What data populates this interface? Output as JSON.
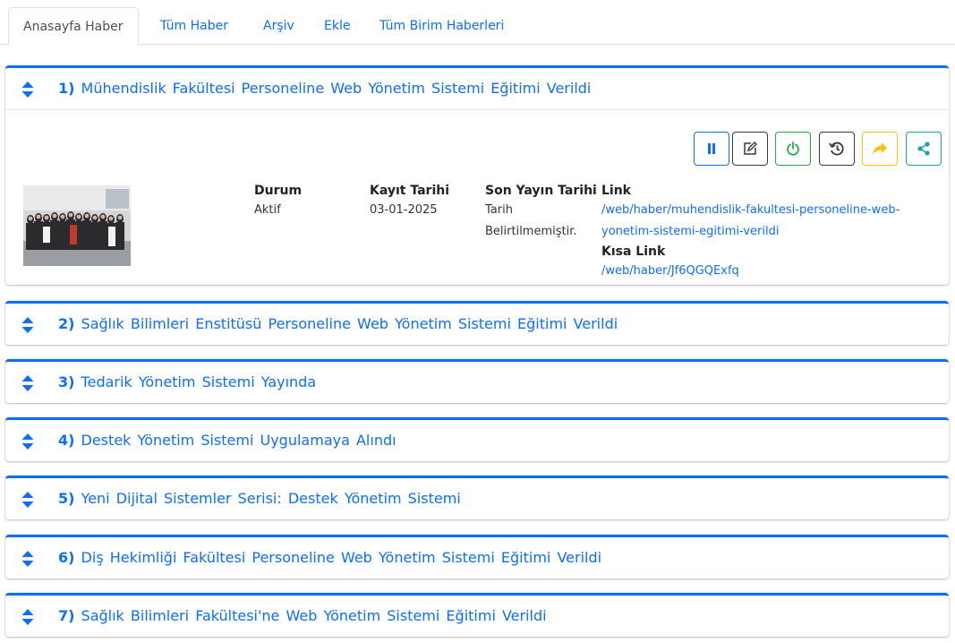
{
  "tabs": [
    {
      "label": "Anasayfa Haber",
      "active": true
    },
    {
      "label": "Tüm Haber",
      "active": false
    },
    {
      "label": "Arşiv",
      "active": false
    },
    {
      "label": "Ekle",
      "active": false
    },
    {
      "label": "Tüm Birim Haberleri",
      "active": false
    }
  ],
  "colors": {
    "primary": "#0d6efd",
    "success": "#28a745",
    "warning": "#ffc107",
    "info": "#17a2b8",
    "dark": "#343a40",
    "secondary": "#6c757d"
  },
  "news": [
    {
      "num": "1)",
      "title": "Mühendislik Fakültesi Personeline Web Yönetim Sistemi Eğitimi Verildi",
      "expanded": true,
      "details": {
        "status_label": "Durum",
        "status_value": "Aktif",
        "record_label": "Kayıt Tarihi",
        "record_value": "03-01-2025",
        "publish_label": "Son Yayın Tarihi",
        "publish_value_line1": "Tarih",
        "publish_value_line2": "Belirtilmemiştir.",
        "link_label": "Link",
        "link_line1": "/web/haber/muhendislik-fakultesi-personeline-web-",
        "link_line2": "yonetim-sistemi-egitimi-verildi",
        "short_link_label": "Kısa Link",
        "short_link_value": "/web/haber/Jf6QGQExfq"
      },
      "actions": [
        {
          "name": "pause-button",
          "icon": "pause-icon",
          "color": "#0d6efd"
        },
        {
          "name": "edit-button",
          "icon": "edit-icon",
          "color": "#343a40"
        },
        {
          "name": "power-button",
          "icon": "power-icon",
          "color": "#28a745"
        },
        {
          "name": "history-button",
          "icon": "history-icon",
          "color": "#343a40"
        },
        {
          "name": "forward-button",
          "icon": "share-arrow-icon",
          "color": "#ffc107"
        },
        {
          "name": "share-button",
          "icon": "share-nodes-icon",
          "color": "#17a2b8"
        }
      ]
    },
    {
      "num": "2)",
      "title": "Sağlık Bilimleri Enstitüsü Personeline Web Yönetim Sistemi Eğitimi Verildi",
      "expanded": false
    },
    {
      "num": "3)",
      "title": "Tedarik Yönetim Sistemi Yayında",
      "expanded": false
    },
    {
      "num": "4)",
      "title": "Destek Yönetim Sistemi Uygulamaya Alındı",
      "expanded": false
    },
    {
      "num": "5)",
      "title": "Yeni Dijital Sistemler Serisi: Destek Yönetim Sistemi",
      "expanded": false
    },
    {
      "num": "6)",
      "title": "Diş Hekimliği Fakültesi Personeline Web Yönetim Sistemi Eğitimi Verildi",
      "expanded": false
    },
    {
      "num": "7)",
      "title": "Sağlık Bilimleri Fakültesi'ne Web Yönetim Sistemi Eğitimi Verildi",
      "expanded": false
    }
  ]
}
